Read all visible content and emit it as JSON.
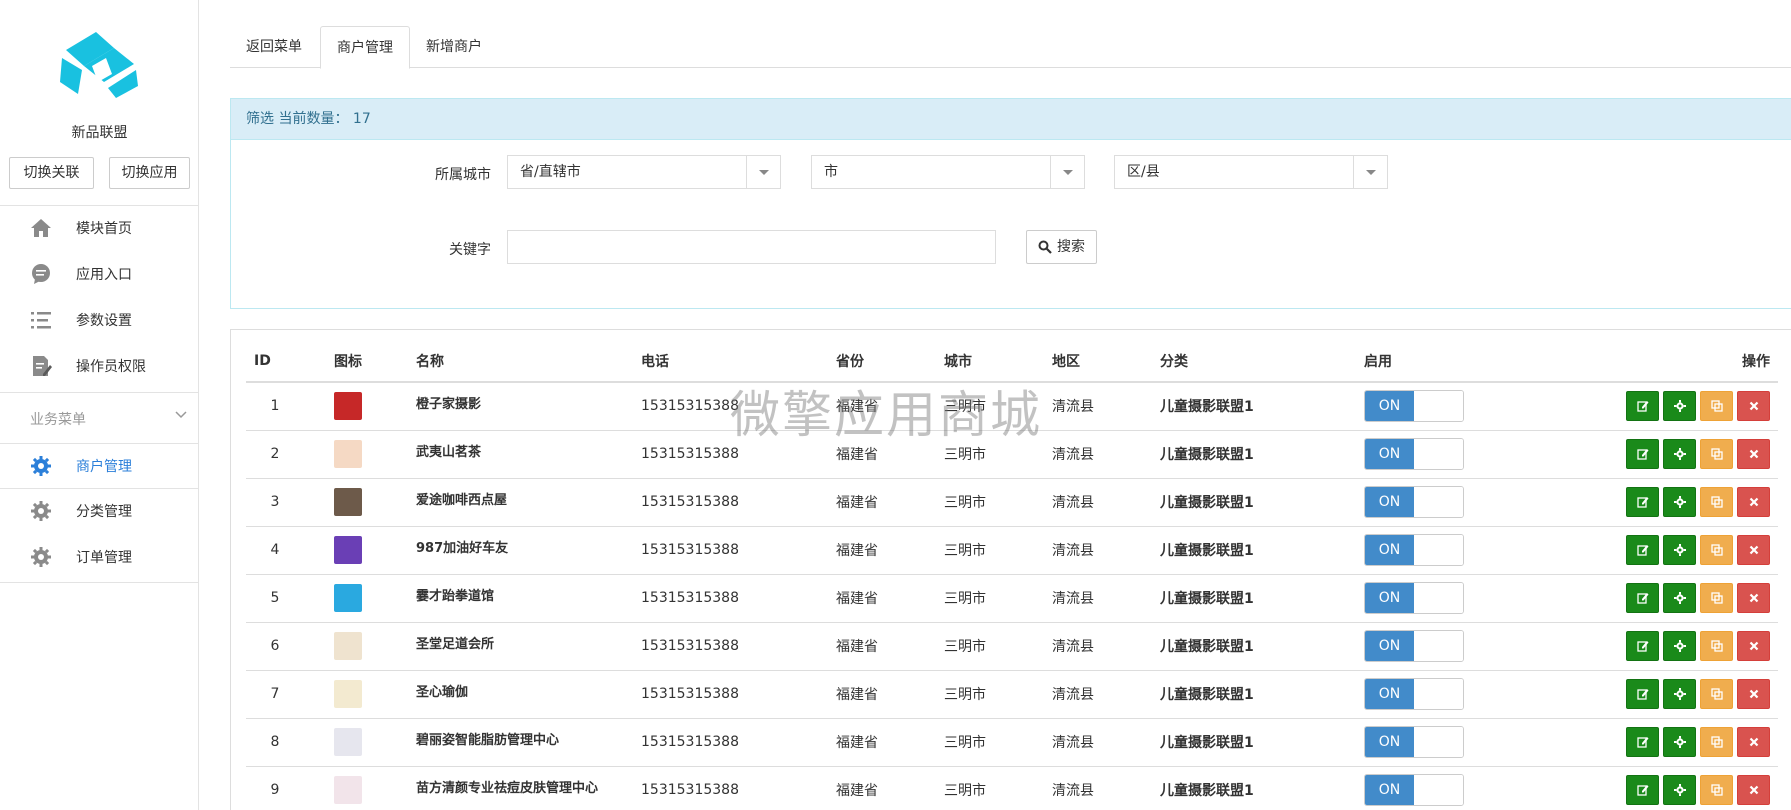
{
  "sidebar": {
    "brand": "新品联盟",
    "switch_union": "切换关联",
    "switch_app": "切换应用",
    "main_items": [
      {
        "label": "模块首页",
        "icon": "home-icon"
      },
      {
        "label": "应用入口",
        "icon": "chat-bubble-icon"
      },
      {
        "label": "参数设置",
        "icon": "list-icon"
      },
      {
        "label": "操作员权限",
        "icon": "edit-document-icon"
      }
    ],
    "section_title": "业务菜单",
    "biz_items": [
      {
        "label": "商户管理",
        "icon": "gear-icon",
        "active": true
      },
      {
        "label": "分类管理",
        "icon": "gear-icon"
      },
      {
        "label": "订单管理",
        "icon": "gear-icon"
      }
    ],
    "accent": "#2b7fd9"
  },
  "tabs": [
    {
      "label": "返回菜单"
    },
    {
      "label": "商户管理",
      "active": true
    },
    {
      "label": "新增商户"
    }
  ],
  "filter": {
    "title": "筛选 当前数量：",
    "count": "17",
    "city_label": "所属城市",
    "province": "省/直辖市",
    "city": "市",
    "district": "区/县",
    "keyword_label": "关键字",
    "keyword_value": "",
    "search_label": "搜索"
  },
  "table": {
    "headers": [
      "ID",
      "图标",
      "名称",
      "电话",
      "省份",
      "城市",
      "地区",
      "分类",
      "启用",
      "操作"
    ],
    "rows": [
      {
        "id": "1",
        "name": "橙子家摄影",
        "phone": "15315315388",
        "province": "福建省",
        "city": "三明市",
        "district": "清流县",
        "category": "儿童摄影联盟1",
        "status": "ON",
        "thumb": "#c62828"
      },
      {
        "id": "2",
        "name": "武夷山茗茶",
        "phone": "15315315388",
        "province": "福建省",
        "city": "三明市",
        "district": "清流县",
        "category": "儿童摄影联盟1",
        "status": "ON",
        "thumb": "#f5d9c4"
      },
      {
        "id": "3",
        "name": "爱途咖啡西点屋",
        "phone": "15315315388",
        "province": "福建省",
        "city": "三明市",
        "district": "清流县",
        "category": "儿童摄影联盟1",
        "status": "ON",
        "thumb": "#6d5a4a"
      },
      {
        "id": "4",
        "name": "987加油好车友",
        "phone": "15315315388",
        "province": "福建省",
        "city": "三明市",
        "district": "清流县",
        "category": "儿童摄影联盟1",
        "status": "ON",
        "thumb": "#6a3fb5"
      },
      {
        "id": "5",
        "name": "霎才跆拳道馆",
        "phone": "15315315388",
        "province": "福建省",
        "city": "三明市",
        "district": "清流县",
        "category": "儿童摄影联盟1",
        "status": "ON",
        "thumb": "#2aa9e0"
      },
      {
        "id": "6",
        "name": "圣堂足道会所",
        "phone": "15315315388",
        "province": "福建省",
        "city": "三明市",
        "district": "清流县",
        "category": "儿童摄影联盟1",
        "status": "ON",
        "thumb": "#efe3cf"
      },
      {
        "id": "7",
        "name": "圣心瑜伽",
        "phone": "15315315388",
        "province": "福建省",
        "city": "三明市",
        "district": "清流县",
        "category": "儿童摄影联盟1",
        "status": "ON",
        "thumb": "#f3ead0"
      },
      {
        "id": "8",
        "name": "碧丽姿智能脂肪管理中心",
        "phone": "15315315388",
        "province": "福建省",
        "city": "三明市",
        "district": "清流县",
        "category": "儿童摄影联盟1",
        "status": "ON",
        "thumb": "#e6e6ee"
      },
      {
        "id": "9",
        "name": "苗方清颜专业祛痘皮肤管理中心",
        "phone": "15315315388",
        "province": "福建省",
        "city": "三明市",
        "district": "清流县",
        "category": "儿童摄影联盟1",
        "status": "ON",
        "thumb": "#f2e4ea"
      }
    ],
    "actions": [
      {
        "name": "edit-button",
        "icon": "edit-icon",
        "color": "#1a8a1a"
      },
      {
        "name": "settings-button",
        "icon": "gear-icon",
        "color": "#1a8a1a"
      },
      {
        "name": "copy-button",
        "icon": "copy-icon",
        "color": "#f0ad4e"
      },
      {
        "name": "delete-button",
        "icon": "close-icon",
        "color": "#d9534f"
      }
    ]
  },
  "watermark": "微擎应用商城"
}
